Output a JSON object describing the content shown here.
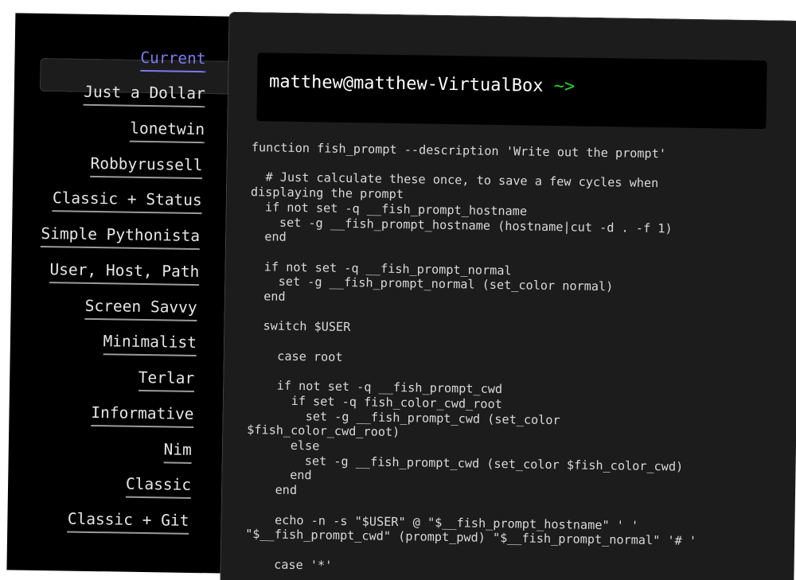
{
  "sidebar": {
    "items": [
      {
        "label": "Current",
        "active": true
      },
      {
        "label": "Just a Dollar",
        "active": false
      },
      {
        "label": "lonetwin",
        "active": false
      },
      {
        "label": "Robbyrussell",
        "active": false
      },
      {
        "label": "Classic + Status",
        "active": false
      },
      {
        "label": "Simple Pythonista",
        "active": false
      },
      {
        "label": "User, Host, Path",
        "active": false
      },
      {
        "label": "Screen Savvy",
        "active": false
      },
      {
        "label": "Minimalist",
        "active": false
      },
      {
        "label": "Terlar",
        "active": false
      },
      {
        "label": "Informative",
        "active": false
      },
      {
        "label": "Nim",
        "active": false
      },
      {
        "label": "Classic",
        "active": false
      },
      {
        "label": "Classic + Git",
        "active": false
      }
    ]
  },
  "preview": {
    "user_host": "matthew@matthew-VirtualBox",
    "arrow": "~>"
  },
  "colors": {
    "active_link": "#7b7bf0",
    "prompt_arrow": "#2bd42b",
    "panel_bg": "#1c1c1c",
    "sidebar_bg": "#000000"
  },
  "code": {
    "lines": [
      "function fish_prompt --description 'Write out the prompt'",
      "",
      "  # Just calculate these once, to save a few cycles when",
      "displaying the prompt",
      "  if not set -q __fish_prompt_hostname",
      "    set -g __fish_prompt_hostname (hostname|cut -d . -f 1)",
      "  end",
      "",
      "  if not set -q __fish_prompt_normal",
      "    set -g __fish_prompt_normal (set_color normal)",
      "  end",
      "",
      "  switch $USER",
      "",
      "    case root",
      "",
      "    if not set -q __fish_prompt_cwd",
      "      if set -q fish_color_cwd_root",
      "        set -g __fish_prompt_cwd (set_color",
      "$fish_color_cwd_root)",
      "      else",
      "        set -g __fish_prompt_cwd (set_color $fish_color_cwd)",
      "      end",
      "    end",
      "",
      "    echo -n -s \"$USER\" @ \"$__fish_prompt_hostname\" ' '",
      "\"$__fish_prompt_cwd\" (prompt_pwd) \"$__fish_prompt_normal\" '# '",
      "",
      "    case '*'"
    ]
  }
}
